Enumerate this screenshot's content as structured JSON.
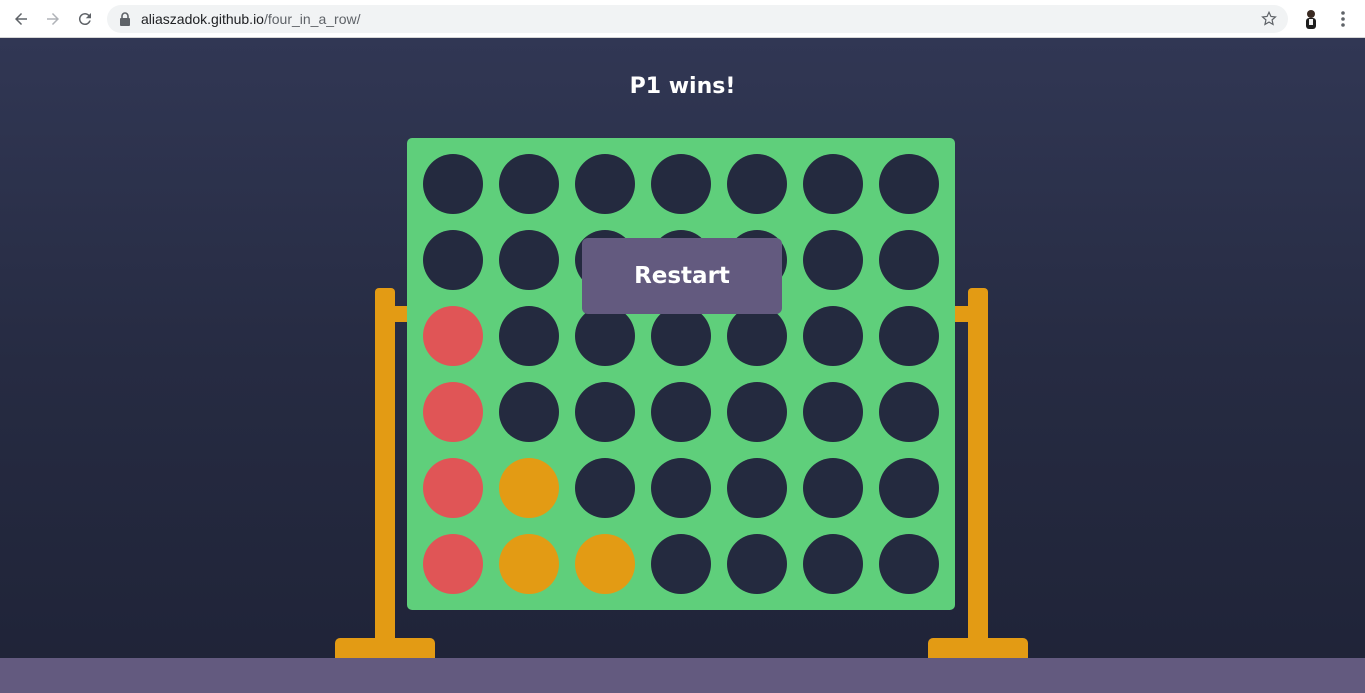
{
  "browser": {
    "url_host": "aliaszadok.github.io",
    "url_path": "/four_in_a_row/"
  },
  "game": {
    "status": "P1 wins!",
    "restart_label": "Restart",
    "colors": {
      "board": "#5fcf7b",
      "empty": "#242a3f",
      "p1": "#e05556",
      "p2": "#e39b14",
      "stand": "#e39b14",
      "floor": "#635a7f",
      "button": "#635a7f"
    },
    "grid": [
      [
        "empty",
        "empty",
        "empty",
        "empty",
        "empty",
        "empty",
        "empty"
      ],
      [
        "empty",
        "empty",
        "empty",
        "empty",
        "empty",
        "empty",
        "empty"
      ],
      [
        "p1",
        "empty",
        "empty",
        "empty",
        "empty",
        "empty",
        "empty"
      ],
      [
        "p1",
        "empty",
        "empty",
        "empty",
        "empty",
        "empty",
        "empty"
      ],
      [
        "p1",
        "p2",
        "empty",
        "empty",
        "empty",
        "empty",
        "empty"
      ],
      [
        "p1",
        "p2",
        "p2",
        "empty",
        "empty",
        "empty",
        "empty"
      ]
    ]
  }
}
